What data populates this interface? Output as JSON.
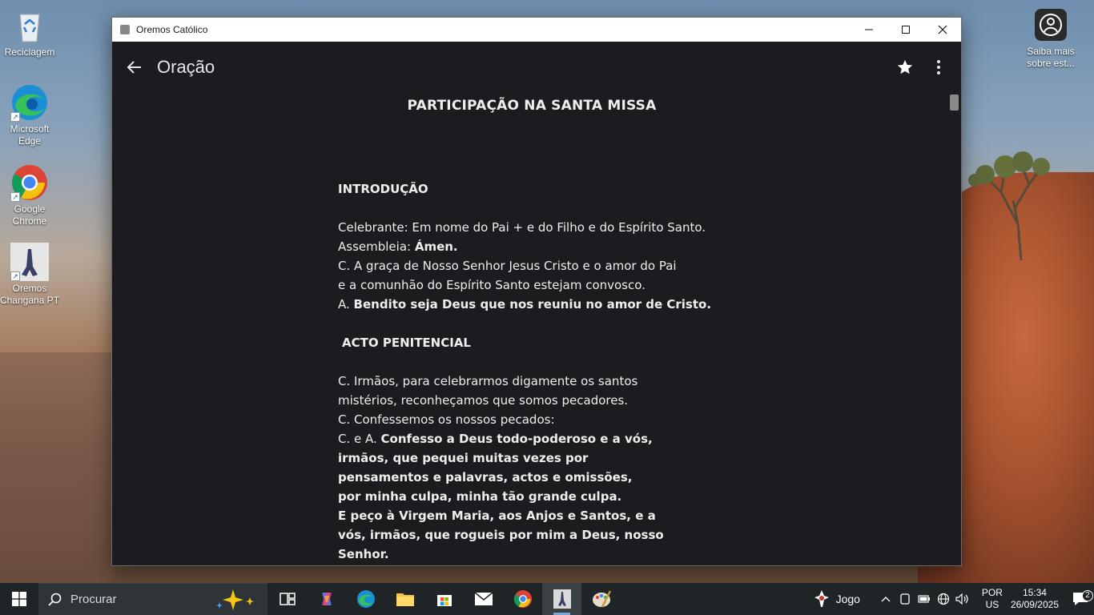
{
  "desktop": {
    "icons": [
      {
        "label": "Reciclagem"
      },
      {
        "label": "Microsoft Edge"
      },
      {
        "label": "Google Chrome"
      },
      {
        "label": "Oremos Changana PT"
      },
      {
        "label": "Saiba mais sobre est..."
      }
    ]
  },
  "window": {
    "title": "Oremos Católico"
  },
  "appbar": {
    "title": "Oração"
  },
  "document": {
    "heading": "PARTICIPAÇÃO NA SANTA MISSA",
    "section1": "INTRODUÇÃO",
    "l1": "Celebrante: Em nome do Pai + e do Filho e do Espírito Santo.",
    "l2a": "Assembleia:  ",
    "l2b": "Ámen.",
    "l3": "C. A graça de Nosso Senhor Jesus Cristo e o amor do Pai",
    "l4": "e a comunhão do Espírito Santo estejam convosco.",
    "l5a": "A.  ",
    "l5b": "Bendito seja Deus que nos reuniu no amor de Cristo.",
    "section2": "ACTO PENITENCIAL",
    "p1": "C. Irmãos, para celebrarmos digamente os santos",
    "p2": "mistérios, reconheçamos que somos pecadores.",
    "p3": "C. Confessemos os nossos pecados:",
    "p4a": "C. e A.  ",
    "p4b": "Confesso a Deus todo-poderoso e a vós,",
    "p5": "irmãos, que pequei muitas vezes por",
    "p6": "pensamentos e palavras, actos e omissões,",
    "p7": "por minha culpa, minha tão grande culpa.",
    "p8": "E peço à Virgem Maria, aos Anjos e Santos, e a",
    "p9": "vós, irmãos, que rogueis por mim a Deus, nosso",
    "p10": "Senhor."
  },
  "taskbar": {
    "search_placeholder": "Procurar",
    "game_label": "Jogo",
    "lang_top": "POR",
    "lang_bottom": "US",
    "time": "15:34",
    "date": "26/09/2025",
    "notifications": "2"
  }
}
